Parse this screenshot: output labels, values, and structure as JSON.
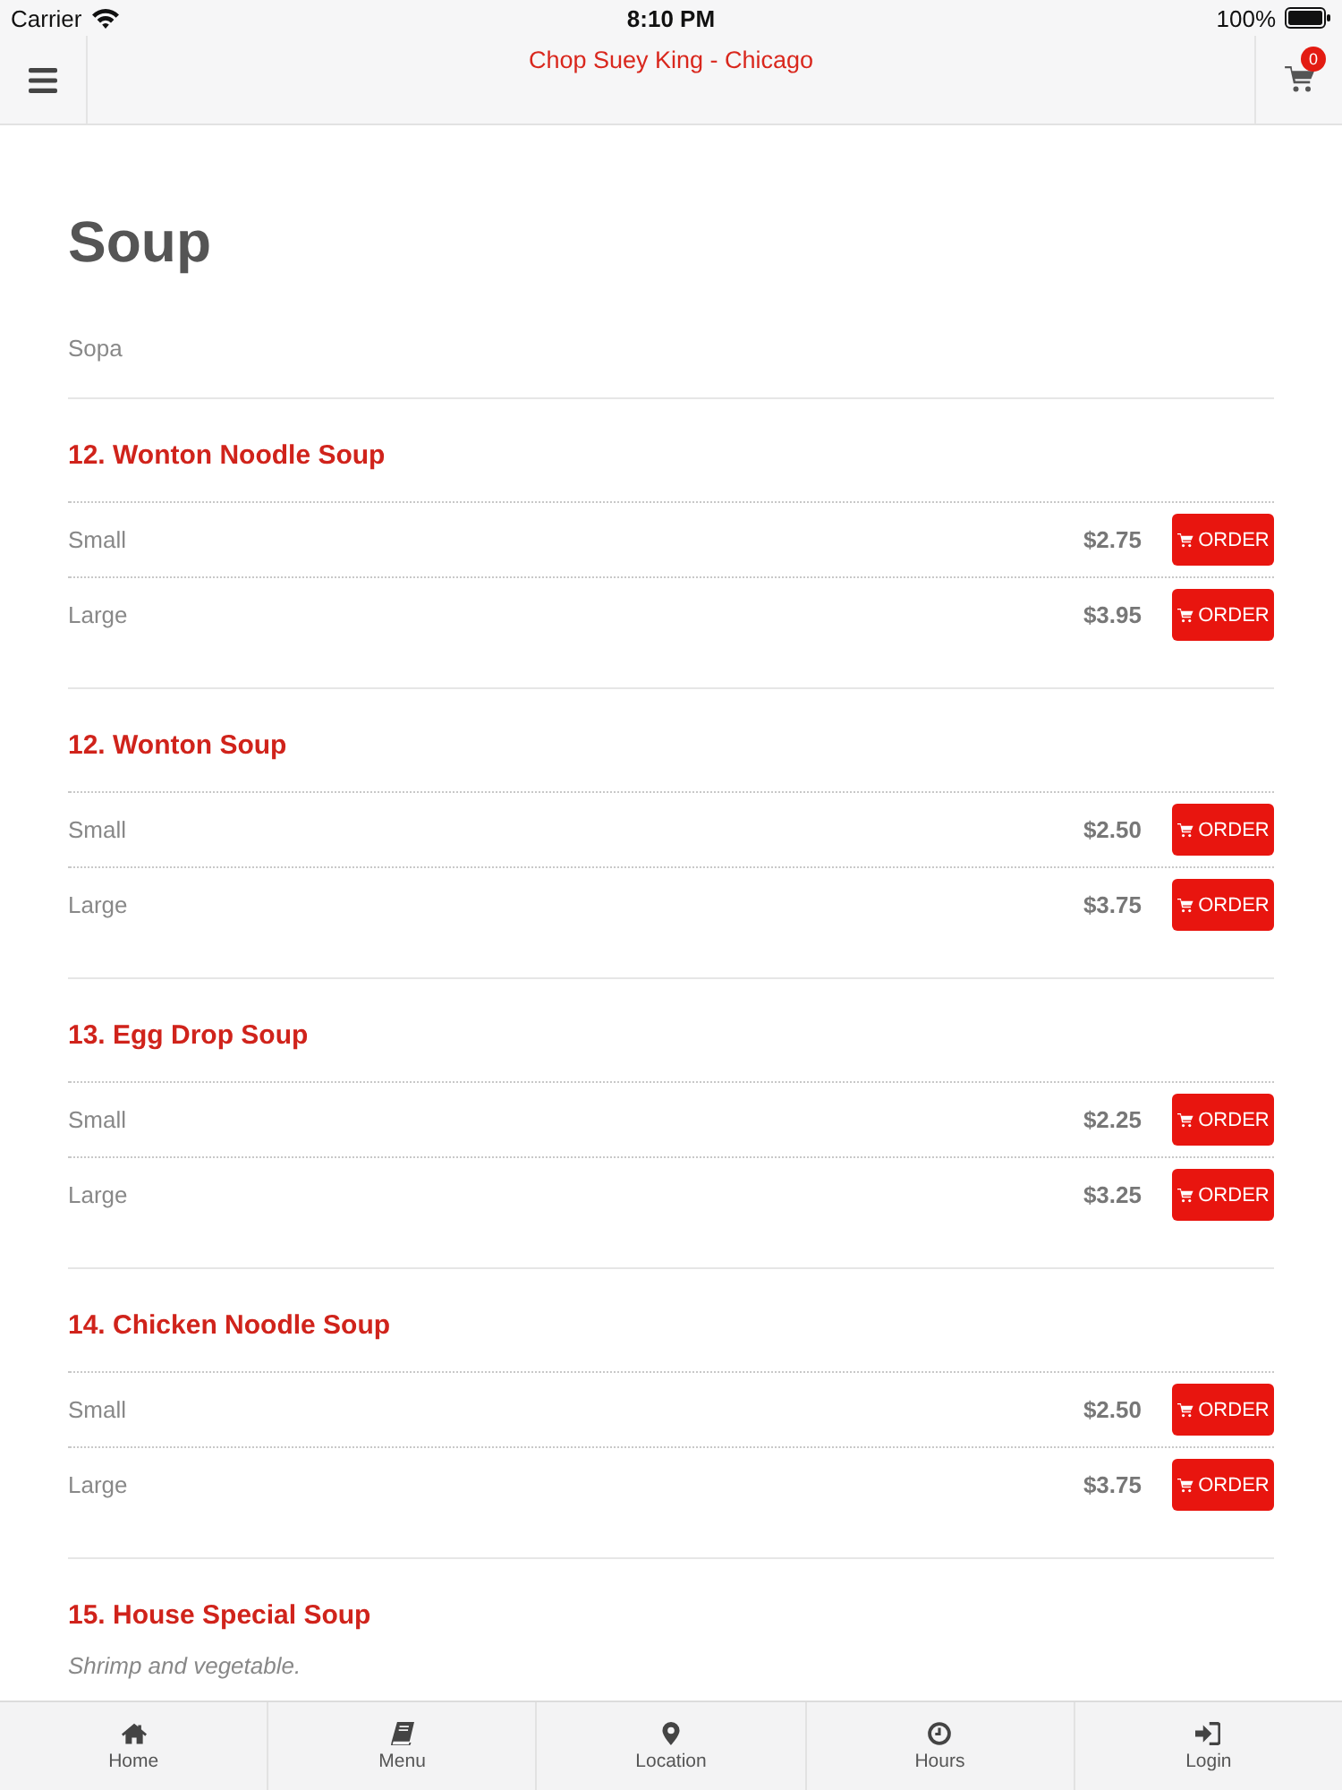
{
  "status_bar": {
    "carrier": "Carrier",
    "time": "8:10 PM",
    "battery": "100%"
  },
  "header": {
    "title": "Chop Suey King - Chicago",
    "cart_count": "0"
  },
  "category": {
    "title": "Soup",
    "subtitle": "Sopa"
  },
  "items": [
    {
      "name": "12. Wonton Noodle Soup",
      "options": [
        {
          "size": "Small",
          "price": "$2.75",
          "button": "ORDER"
        },
        {
          "size": "Large",
          "price": "$3.95",
          "button": "ORDER"
        }
      ]
    },
    {
      "name": "12. Wonton Soup",
      "options": [
        {
          "size": "Small",
          "price": "$2.50",
          "button": "ORDER"
        },
        {
          "size": "Large",
          "price": "$3.75",
          "button": "ORDER"
        }
      ]
    },
    {
      "name": "13. Egg Drop Soup",
      "options": [
        {
          "size": "Small",
          "price": "$2.25",
          "button": "ORDER"
        },
        {
          "size": "Large",
          "price": "$3.25",
          "button": "ORDER"
        }
      ]
    },
    {
      "name": "14. Chicken Noodle Soup",
      "options": [
        {
          "size": "Small",
          "price": "$2.50",
          "button": "ORDER"
        },
        {
          "size": "Large",
          "price": "$3.75",
          "button": "ORDER"
        }
      ]
    },
    {
      "name": "15. House Special Soup",
      "description": "Shrimp and vegetable."
    }
  ],
  "tab_bar": [
    {
      "label": "Home"
    },
    {
      "label": "Menu"
    },
    {
      "label": "Location"
    },
    {
      "label": "Hours"
    },
    {
      "label": "Login"
    }
  ]
}
